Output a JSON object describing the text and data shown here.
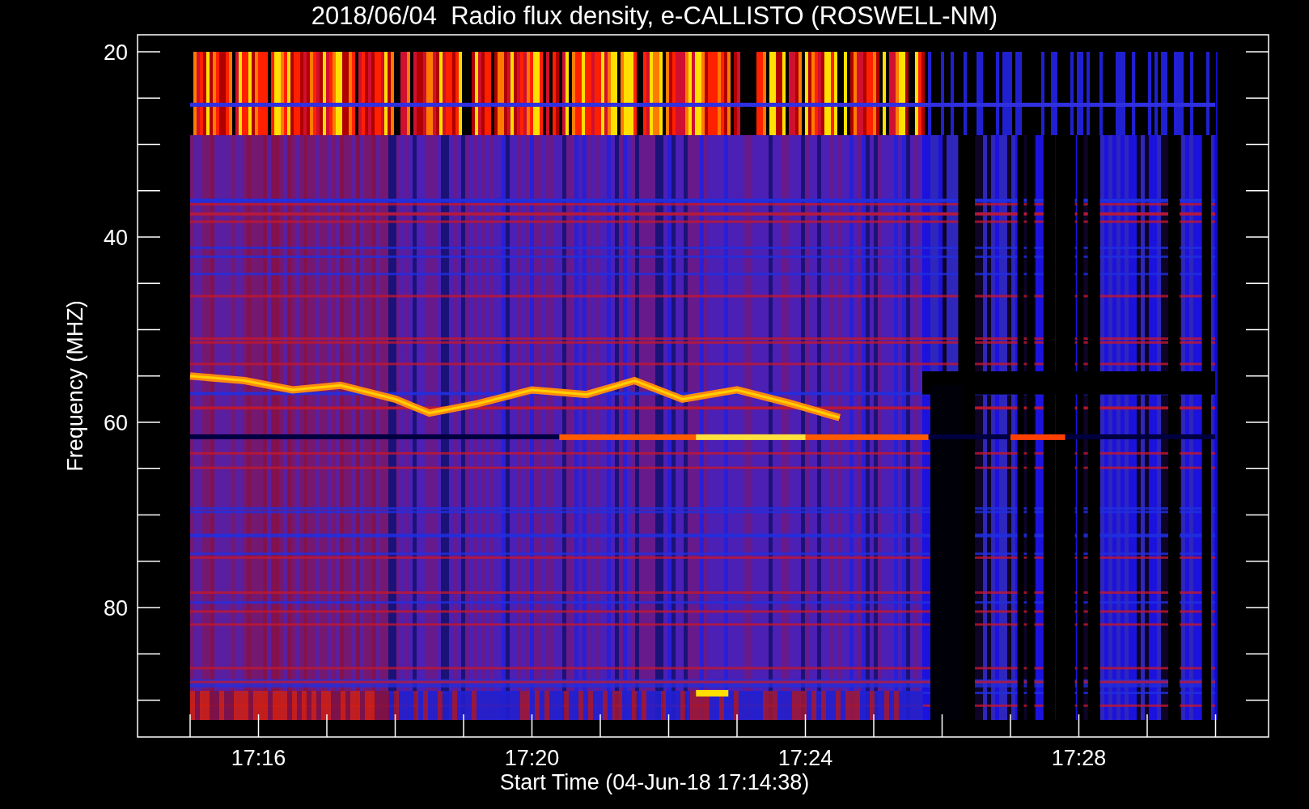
{
  "title": "2018/06/04  Radio flux density, e-CALLISTO (ROSWELL-NM)",
  "ylabel": "Frequency (MHZ)",
  "xlabel": "Start Time (04-Jun-18 17:14:38)",
  "yticks": [
    "20",
    "40",
    "60",
    "80"
  ],
  "xticks": [
    "17:16",
    "17:20",
    "17:24",
    "17:28"
  ]
}
